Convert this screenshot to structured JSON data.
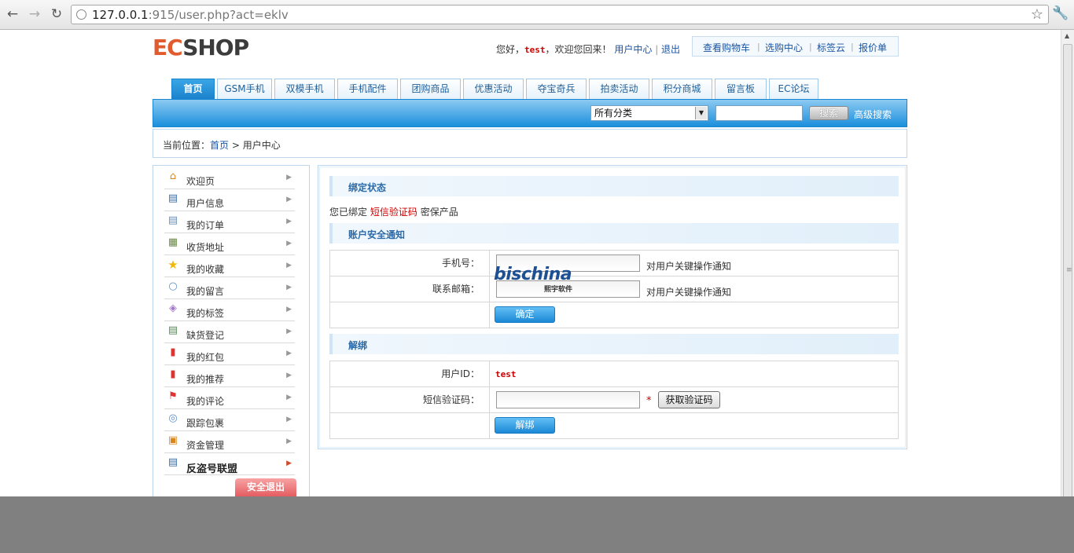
{
  "browser": {
    "url_host": "127.0.0.1",
    "url_rest": ":915/user.php?act=eklv"
  },
  "header": {
    "logo_ec": "EC",
    "logo_shop": "SHOP",
    "greeting": "您好，",
    "username": "test",
    "welcome": "，欢迎您回来！",
    "user_center": "用户中心",
    "logout": "退出",
    "top_links": [
      "查看购物车",
      "选购中心",
      "标签云",
      "报价单"
    ]
  },
  "nav": {
    "tabs": [
      "首页",
      "GSM手机",
      "双模手机",
      "手机配件",
      "团购商品",
      "优惠活动",
      "夺宝奇兵",
      "拍卖活动",
      "积分商城",
      "留言板",
      "EC论坛"
    ],
    "active_index": 0
  },
  "search": {
    "category": "所有分类",
    "keyword": "",
    "button": "搜索",
    "advanced": "高级搜索"
  },
  "breadcrumb": {
    "label": "当前位置：",
    "home": "首页",
    "sep": " > ",
    "current": "用户中心"
  },
  "sidebar": {
    "items": [
      {
        "label": "欢迎页",
        "icon": "home-icon"
      },
      {
        "label": "用户信息",
        "icon": "id-card-icon"
      },
      {
        "label": "我的订单",
        "icon": "document-icon"
      },
      {
        "label": "收货地址",
        "icon": "address-book-icon"
      },
      {
        "label": "我的收藏",
        "icon": "star-icon"
      },
      {
        "label": "我的留言",
        "icon": "speech-bubble-icon"
      },
      {
        "label": "我的标签",
        "icon": "tag-icon"
      },
      {
        "label": "缺货登记",
        "icon": "list-icon"
      },
      {
        "label": "我的红包",
        "icon": "red-envelope-icon"
      },
      {
        "label": "我的推荐",
        "icon": "recommend-icon"
      },
      {
        "label": "我的评论",
        "icon": "flag-icon"
      },
      {
        "label": "跟踪包裹",
        "icon": "package-icon"
      },
      {
        "label": "资金管理",
        "icon": "wallet-icon"
      },
      {
        "label": "反盗号联盟",
        "icon": "id-card-icon"
      }
    ],
    "logout_button": "安全退出"
  },
  "content": {
    "bind_status_title": "绑定状态",
    "bind_status_prefix": "您已绑定",
    "bind_status_method": "短信验证码",
    "bind_status_suffix": "密保产品",
    "notify_title": "账户安全通知",
    "phone_label": "手机号：",
    "phone_value": "",
    "phone_hint": "对用户关键操作通知",
    "email_label": "联系邮箱：",
    "email_value": "",
    "email_hint": "对用户关键操作通知",
    "confirm_button": "确定",
    "unbind_title": "解绑",
    "userid_label": "用户ID：",
    "userid_value": "test",
    "sms_label": "短信验证码：",
    "sms_value": "",
    "required_mark": "*",
    "get_code_button": "获取验证码",
    "unbind_button": "解绑"
  },
  "watermark": {
    "brand": "bischina",
    "sub": "熙宇软件"
  },
  "colors": {
    "accent_blue": "#1b82cc",
    "link_blue": "#1a55a4",
    "alert_red": "#cc0000"
  }
}
